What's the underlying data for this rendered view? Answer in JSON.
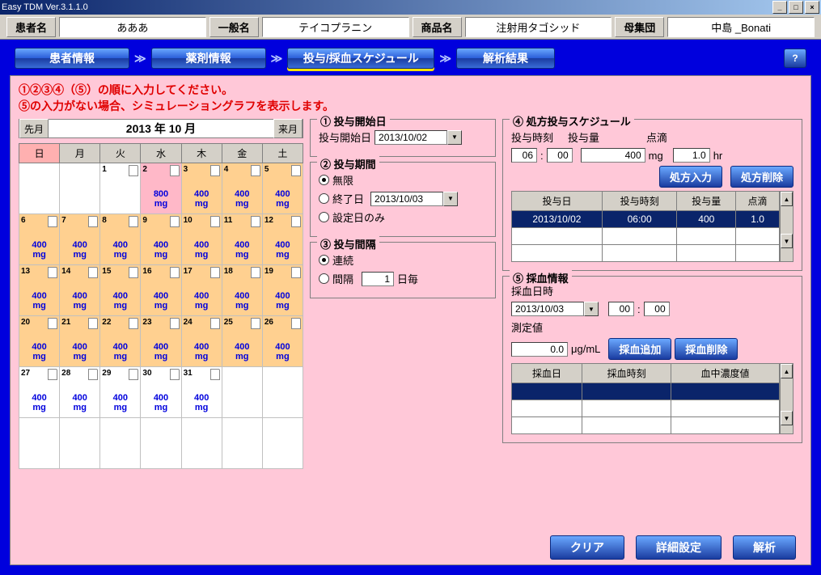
{
  "title": "Easy TDM Ver.3.1.1.0",
  "header": {
    "patient_lbl": "患者名",
    "patient": "あああ",
    "generic_lbl": "一般名",
    "generic": "テイコプラニン",
    "product_lbl": "商品名",
    "product": "注射用タゴシッド",
    "pop_lbl": "母集団",
    "pop": "中島 _Bonati"
  },
  "nav": {
    "tab1": "患者情報",
    "tab2": "薬剤情報",
    "tab3": "投与/採血スケジュール",
    "tab4": "解析結果",
    "help": "?"
  },
  "msg": {
    "l1": "①②③④（⑤）の順に入力してください。",
    "l2": "⑤の入力がない場合、シミュレーショングラフを表示します。"
  },
  "cal": {
    "prev": "先月",
    "next": "来月",
    "month": "2013 年 10 月",
    "dow": [
      "日",
      "月",
      "火",
      "水",
      "木",
      "金",
      "土"
    ],
    "cells": [
      {
        "d": "",
        "cls": ""
      },
      {
        "d": "",
        "cls": ""
      },
      {
        "d": "1",
        "cls": ""
      },
      {
        "d": "2",
        "cls": "pink",
        "dose": "800\nmg"
      },
      {
        "d": "3",
        "cls": "orange",
        "dose": "400\nmg"
      },
      {
        "d": "4",
        "cls": "orange",
        "dose": "400\nmg"
      },
      {
        "d": "5",
        "cls": "orange",
        "dose": "400\nmg"
      },
      {
        "d": "6",
        "cls": "orange",
        "dose": "400\nmg"
      },
      {
        "d": "7",
        "cls": "orange",
        "dose": "400\nmg"
      },
      {
        "d": "8",
        "cls": "orange",
        "dose": "400\nmg"
      },
      {
        "d": "9",
        "cls": "orange",
        "dose": "400\nmg"
      },
      {
        "d": "10",
        "cls": "orange",
        "dose": "400\nmg"
      },
      {
        "d": "11",
        "cls": "orange",
        "dose": "400\nmg"
      },
      {
        "d": "12",
        "cls": "orange",
        "dose": "400\nmg"
      },
      {
        "d": "13",
        "cls": "orange",
        "dose": "400\nmg"
      },
      {
        "d": "14",
        "cls": "orange",
        "dose": "400\nmg"
      },
      {
        "d": "15",
        "cls": "orange",
        "dose": "400\nmg"
      },
      {
        "d": "16",
        "cls": "orange",
        "dose": "400\nmg"
      },
      {
        "d": "17",
        "cls": "orange",
        "dose": "400\nmg"
      },
      {
        "d": "18",
        "cls": "orange",
        "dose": "400\nmg"
      },
      {
        "d": "19",
        "cls": "orange",
        "dose": "400\nmg"
      },
      {
        "d": "20",
        "cls": "orange",
        "dose": "400\nmg"
      },
      {
        "d": "21",
        "cls": "orange",
        "dose": "400\nmg"
      },
      {
        "d": "22",
        "cls": "orange",
        "dose": "400\nmg"
      },
      {
        "d": "23",
        "cls": "orange",
        "dose": "400\nmg"
      },
      {
        "d": "24",
        "cls": "orange",
        "dose": "400\nmg"
      },
      {
        "d": "25",
        "cls": "orange",
        "dose": "400\nmg"
      },
      {
        "d": "26",
        "cls": "orange",
        "dose": "400\nmg"
      },
      {
        "d": "27",
        "cls": "",
        "dose": "400\nmg"
      },
      {
        "d": "28",
        "cls": "",
        "dose": "400\nmg"
      },
      {
        "d": "29",
        "cls": "",
        "dose": "400\nmg"
      },
      {
        "d": "30",
        "cls": "",
        "dose": "400\nmg"
      },
      {
        "d": "31",
        "cls": "",
        "dose": "400\nmg"
      },
      {
        "d": "",
        "cls": ""
      },
      {
        "d": "",
        "cls": ""
      },
      {
        "d": "",
        "cls": ""
      },
      {
        "d": "",
        "cls": ""
      },
      {
        "d": "",
        "cls": ""
      },
      {
        "d": "",
        "cls": ""
      },
      {
        "d": "",
        "cls": ""
      },
      {
        "d": "",
        "cls": ""
      },
      {
        "d": "",
        "cls": ""
      }
    ]
  },
  "g1": {
    "t": "① 投与開始日",
    "lbl": "投与開始日",
    "date": "2013/10/02"
  },
  "g2": {
    "t": "② 投与期間",
    "r1": "無限",
    "r2": "終了日",
    "r3": "設定日のみ",
    "date": "2013/10/03"
  },
  "g3": {
    "t": "③ 投与間隔",
    "r1": "連続",
    "r2": "間隔",
    "val": "1",
    "unit": "日毎"
  },
  "g4": {
    "t": "④ 処方投与スケジュール",
    "time_lbl": "投与時刻",
    "dose_lbl": "投与量",
    "drip_lbl": "点滴",
    "h": "06",
    "m": "00",
    "dose": "400",
    "dose_u": "mg",
    "drip": "1.0",
    "drip_u": "hr",
    "add": "処方入力",
    "del": "処方削除",
    "cols": [
      "投与日",
      "投与時刻",
      "投与量",
      "点滴"
    ],
    "rows": [
      {
        "c": [
          "2013/10/02",
          "06:00",
          "400",
          "1.0"
        ]
      }
    ]
  },
  "g5": {
    "t": "⑤ 採血情報",
    "dt_lbl": "採血日時",
    "date": "2013/10/03",
    "h": "00",
    "m": "00",
    "val_lbl": "測定値",
    "val": "0.0",
    "unit": "μg/mL",
    "add": "採血追加",
    "del": "採血削除",
    "cols": [
      "採血日",
      "採血時刻",
      "血中濃度値"
    ]
  },
  "bottom": {
    "clear": "クリア",
    "detail": "詳細設定",
    "run": "解析"
  }
}
